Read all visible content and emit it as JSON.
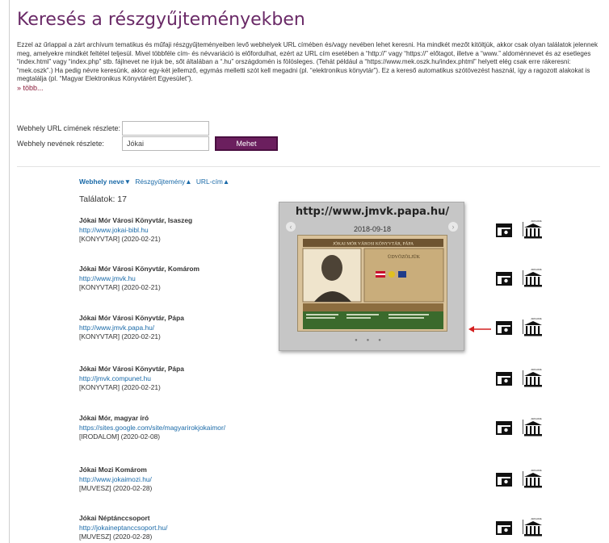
{
  "page": {
    "title": "Keresés a részgyűjteményekben",
    "intro": "Ezzel az űrlappal a zárt archívum tematikus és műfaji részgyűjteményeiben levő webhelyek URL címében és/vagy nevében lehet keresni. Ha mindkét mezőt kitöltjük, akkor csak olyan találatok jelennek meg, amelyekre mindkét feltétel teljesül. Mivel többféle cím- és névvariáció is előfordulhat, ezért az URL cím esetében a “http://” vagy “https://” előtagot, illetve a “www.” aldomènnevet és az esetleges “index.html” vagy “index.php” stb. fájlnevet ne írjuk be, sőt általában a “.hu” országdomén is fölösleges. (Tehát például a “https://www.mek.oszk.hu/index.phtml” helyett elég csak erre rákeresni: “mek.oszk”.) Ha pedig névre keresünk, akkor egy-két jellemző, egymás melletti szót kell megadni (pl. “elektronikus könyvtár”). Ez a kereső automatikus szótövezést használ, így a ragozott alakokat is megtalálja (pl. “Magyar Elektronikus Könyvtárért Egyesület”).",
    "more_link": "» több..."
  },
  "form": {
    "url_label": "Webhely URL címének részlete:",
    "url_value": "",
    "name_label": "Webhely nevének részlete:",
    "name_value": "Jókai",
    "submit_label": "Mehet"
  },
  "sort": {
    "name": "Webhely neve▼",
    "collection": "Részgyűjtemény▲",
    "url": "URL-cím▲"
  },
  "results_count": "Találatok: 17",
  "results": [
    {
      "name": "Jókai Mór Városi Könyvtár, Isaszeg",
      "url": "http://www.jokai-bibl.hu",
      "meta": "[KONYVTAR] (2020-02-21)"
    },
    {
      "name": "Jókai Mór Városi Könyvtár, Komárom",
      "url": "http://www.jmvk.hu",
      "meta": "[KONYVTAR] (2020-02-21)"
    },
    {
      "name": "Jókai Mór Városi Könyvtár, Pápa",
      "url": "http://www.jmvk.papa.hu/",
      "meta": "[KONYVTAR] (2020-02-21)"
    },
    {
      "name": "Jókai Mór Városi Könyvtár, Pápa",
      "url": "http://jmvk.compunet.hu",
      "meta": "[KONYVTAR] (2020-02-21)"
    },
    {
      "name": "Jókai Mór, magyar író",
      "url": "https://sites.google.com/site/magyarirokjokaimor/",
      "meta": "[IRODALOM] (2020-02-08)"
    },
    {
      "name": "Jókai Mozi Komárom",
      "url": "http://www.jokaimozi.hu/",
      "meta": "[MUVESZ] (2020-02-28)"
    },
    {
      "name": "Jókai Néptánccsoport",
      "url": "http://jokaineptanccsoport.hu/",
      "meta": "[MUVESZ] (2020-02-28)"
    }
  ],
  "preview": {
    "url": "http://www.jmvk.papa.hu/",
    "date": "2018-09-18",
    "thumb_header": "JÓKAI MÓR VÁROSI KÖNYVTÁR, PÁPA",
    "thumb_word": "ÜDVÖZÖLJÜK"
  },
  "colors": {
    "title": "#6a2a67",
    "link": "#1a6aa8",
    "button": "#6b1f5e",
    "arrow": "#d42020"
  },
  "icons": {
    "screenshot": "camera-window-icon",
    "archive": "archive-building-icon",
    "archive_label": "ARCHIVE"
  }
}
